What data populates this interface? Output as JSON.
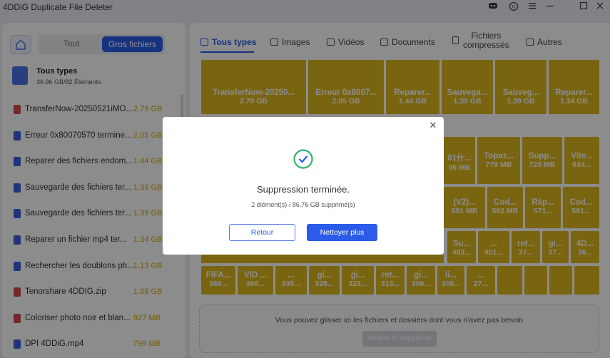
{
  "window": {
    "title": "4DDiG Duplicate File Deleter"
  },
  "sidebar": {
    "tabs": {
      "all": "Tout",
      "large": "Gros fichiers"
    },
    "summary": {
      "title": "Tous types",
      "subtitle": "36.96 GB/82 Éléments"
    },
    "files": [
      {
        "name": "TransferNow-20250521iMO...",
        "size": "2.79 GB",
        "icon": "pdf-file-icon",
        "color": "#d24b4b"
      },
      {
        "name": "Erreur 0x80070570 termine...",
        "size": "2.05 GB",
        "icon": "word-file-icon",
        "color": "#3b5fdc"
      },
      {
        "name": "Reparer des fichiers endom...",
        "size": "1.44 GB",
        "icon": "word-file-icon",
        "color": "#3b5fdc"
      },
      {
        "name": "Sauvegarde des fichiers ter...",
        "size": "1.39 GB",
        "icon": "word-file-icon",
        "color": "#3b5fdc"
      },
      {
        "name": "Sauvegarde des fichiers ter...",
        "size": "1.39 GB",
        "icon": "word-file-icon",
        "color": "#3b5fdc"
      },
      {
        "name": "Reparer un fichier mp4 ter...",
        "size": "1.34 GB",
        "icon": "word-file-icon",
        "color": "#3b5fdc"
      },
      {
        "name": "Rechercher les doublons ph...",
        "size": "1.13 GB",
        "icon": "word-file-icon",
        "color": "#3b5fdc"
      },
      {
        "name": "Tenorshare 4DDIG.zip",
        "size": "1.08 GB",
        "icon": "zip-file-icon",
        "color": "#d24b4b"
      },
      {
        "name": "Coloriser photo noir et blan...",
        "size": "927 MB",
        "icon": "pdf-file-icon",
        "color": "#d24b4b"
      },
      {
        "name": "DPI 4DDiG.mp4",
        "size": "799 MB",
        "icon": "video-file-icon",
        "color": "#3b5fdc"
      }
    ]
  },
  "tabs": {
    "all": "Tous types",
    "images": "Images",
    "videos": "Vidéos",
    "documents": "Documents",
    "archives_line1": "Fichiers",
    "archives_line2": "compressés",
    "other": "Autres"
  },
  "tiles": {
    "t1": {
      "name": "TransferNow-20250...",
      "size": "2.79 GB"
    },
    "t2": {
      "name": "Erreur 0x8007...",
      "size": "2.05 GB"
    },
    "t3": {
      "name": "Reparer...",
      "size": "1.44 GB"
    },
    "t4": {
      "name": "Sauvega...",
      "size": "1.39 GB"
    },
    "t5": {
      "name": "Sauveg...",
      "size": "1.39 GB"
    },
    "t6": {
      "name": "Reparer...",
      "size": "1.34 GB"
    },
    "t7": {
      "name": "01什...",
      "size": "96 MB"
    },
    "t8": {
      "name": "Topaz...",
      "size": "779 MB"
    },
    "t9": {
      "name": "Supp...",
      "size": "723 MB"
    },
    "t10": {
      "name": "Vite...",
      "size": "634..."
    },
    "t11": {
      "name": "(V2)...",
      "size": "591 MB"
    },
    "t12": {
      "name": "Cod...",
      "size": "582 MB"
    },
    "t13": {
      "name": "Rép...",
      "size": "571..."
    },
    "t14": {
      "name": "Cod...",
      "size": "561..."
    },
    "t15": {
      "name": "Su...",
      "size": "403..."
    },
    "t16": {
      "name": "...",
      "size": "401..."
    },
    "t17": {
      "name": "ret...",
      "size": "37..."
    },
    "t18": {
      "name": "gi...",
      "size": "37..."
    },
    "t19": {
      "name": "4D...",
      "size": "36..."
    },
    "t20": {
      "name": "FIFA...",
      "size": "369..."
    },
    "t21": {
      "name": "VID ...",
      "size": "368..."
    },
    "t22": {
      "name": "...",
      "size": "335..."
    },
    "t23": {
      "name": "gi...",
      "size": "328..."
    },
    "t24": {
      "name": "gi...",
      "size": "323..."
    },
    "t25": {
      "name": "ret...",
      "size": "313..."
    },
    "t26": {
      "name": "gi...",
      "size": "306..."
    },
    "t27": {
      "name": "li...",
      "size": "305..."
    },
    "t28": {
      "name": "...",
      "size": "27..."
    }
  },
  "dropzone": {
    "text": "Vous pouvez glisser ici les fichiers et dossiers dont vous n'avez pas besoin",
    "button": "Vérifier et supprimer"
  },
  "modal": {
    "title": "Suppression terminée.",
    "subtitle": "2 élément(s) / 86.76 GB supprimé(s)",
    "back_button": "Retour",
    "more_button": "Nettoyer plus",
    "close": "✕"
  },
  "colors": {
    "accent": "#2b5be8",
    "tile": "#dcb71e",
    "success": "#2fb36b"
  }
}
